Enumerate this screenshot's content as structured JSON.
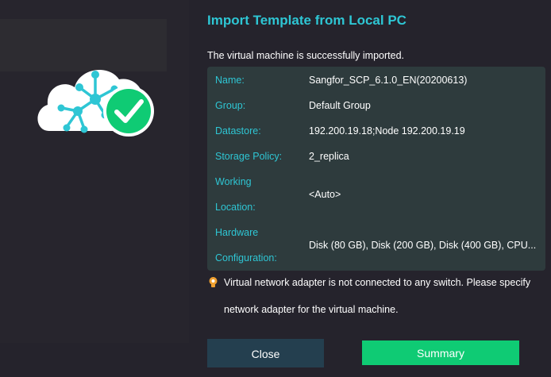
{
  "dialog": {
    "title": "Import Template from Local PC",
    "success_message": "The virtual machine is successfully imported."
  },
  "details": [
    {
      "label": "Name:",
      "value": "Sangfor_SCP_6.1.0_EN(20200613)"
    },
    {
      "label": "Group:",
      "value": "Default Group"
    },
    {
      "label": "Datastore:",
      "value": "192.200.19.18;Node 192.200.19.19"
    },
    {
      "label": "Storage Policy:",
      "value": "2_replica"
    },
    {
      "label_line1": "Working",
      "label_line2": "Location:",
      "value": "<Auto>"
    },
    {
      "label_line1": "Hardware",
      "label_line2": "Configuration:",
      "value": "Disk (80 GB), Disk (200 GB), Disk (400 GB), CPU..."
    }
  ],
  "warning": {
    "line1": "Virtual network adapter is not connected to any switch. Please specify",
    "line2": "network adapter for the virtual machine."
  },
  "buttons": {
    "close": "Close",
    "summary": "Summary"
  },
  "icons": {
    "illustration": "cloud-network-icon",
    "success": "checkmark-circle-icon",
    "warning": "lightbulb-warning-icon"
  },
  "colors": {
    "accent": "#2ec6d4",
    "success": "#0fcb74",
    "warning": "#f0a030",
    "panel": "#2e3b3d",
    "background": "#25232c",
    "close_button": "#243f4f"
  }
}
